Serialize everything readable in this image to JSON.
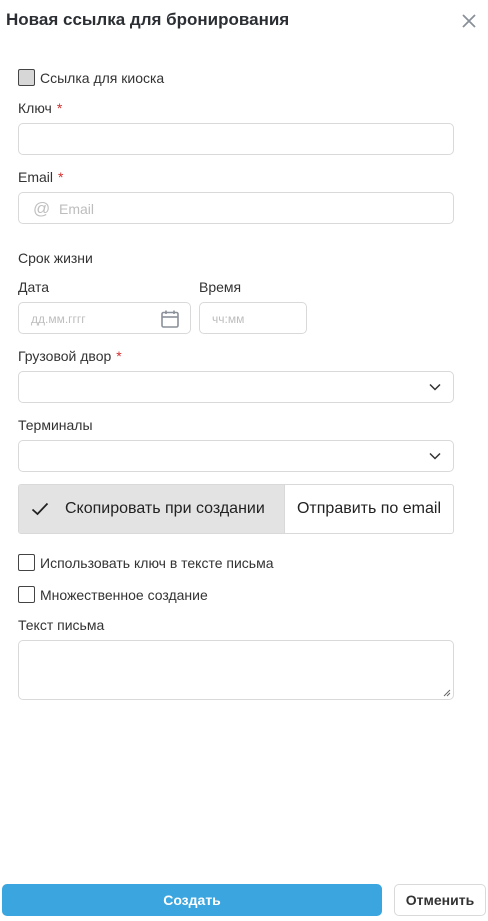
{
  "header": {
    "title": "Новая ссылка для бронирования",
    "close_icon": "close-icon"
  },
  "kiosk": {
    "label": "Ссылка для киоска",
    "checked": false
  },
  "key": {
    "label": "Ключ",
    "required_mark": "*",
    "value": ""
  },
  "email": {
    "label": "Email",
    "required_mark": "*",
    "placeholder": "Email",
    "icon_glyph": "@"
  },
  "lifetime": {
    "label": "Срок жизни",
    "date_label": "Дата",
    "date_placeholder": "дд.мм.гггг",
    "time_label": "Время",
    "time_placeholder": "чч:мм"
  },
  "yard": {
    "label": "Грузовой двор",
    "required_mark": "*",
    "value": ""
  },
  "terminals": {
    "label": "Терминалы",
    "value": ""
  },
  "delivery": {
    "options": [
      "Скопировать при создании",
      "Отправить по email"
    ],
    "selected": "Скопировать при создании"
  },
  "use_key_in_text": {
    "label": "Использовать ключ в тексте письма",
    "checked": false
  },
  "bulk_create": {
    "label": "Множественное создание",
    "checked": false
  },
  "letter_text": {
    "label": "Текст письма",
    "value": ""
  },
  "footer": {
    "create_label": "Создать",
    "cancel_label": "Отменить"
  },
  "colors": {
    "primary": "#3aa5de",
    "required": "#d32f2f",
    "selected_segment": "#e3e3e3"
  }
}
